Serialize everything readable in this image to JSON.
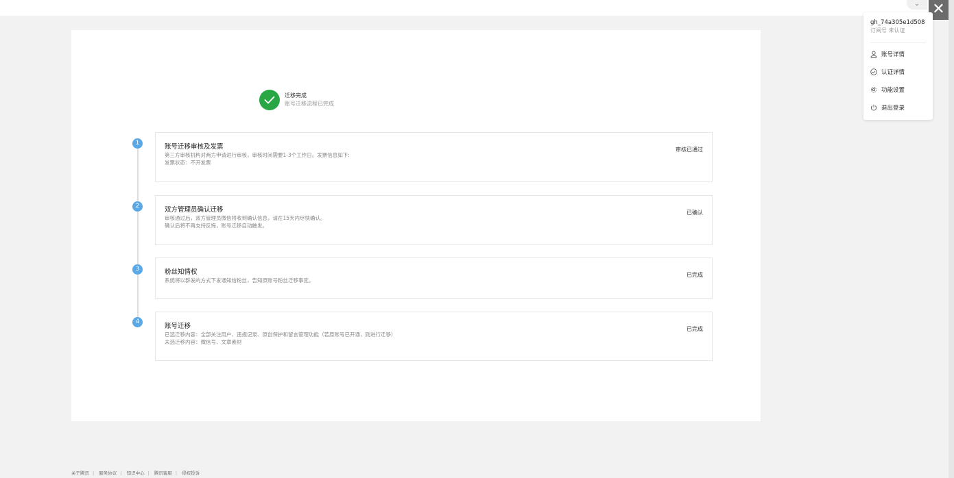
{
  "topbar": {
    "chevron_icon": "chevron-down-icon",
    "close_icon": "close-icon",
    "close_glyph": "✕",
    "chevron_glyph": "⌄"
  },
  "success": {
    "icon": "check-circle-icon",
    "title": "迁移完成",
    "subtitle": "账号迁移流程已完成",
    "color": "#29a745"
  },
  "steps": [
    {
      "number": "1",
      "title": "账号迁移审核及发票",
      "desc": [
        "第三方审核机构对两方申请进行审核，审核时间需要1-3个工作日。发票信息如下:",
        "发票状态：不开发票"
      ],
      "status": "审核已通过"
    },
    {
      "number": "2",
      "title": "双方管理员确认迁移",
      "desc": [
        "审核通过后，双方管理员微信将收到确认信息，请在15天内尽快确认。",
        "确认后将不再支持反悔，账号迁移自动触发。"
      ],
      "status": "已确认"
    },
    {
      "number": "3",
      "title": "粉丝知情权",
      "desc": [
        "系统将以群发的方式下发通知给粉丝，告知原账号粉丝迁移事宜。"
      ],
      "status": "已完成"
    },
    {
      "number": "4",
      "title": "账号迁移",
      "desc": [
        "已选迁移内容：全部关注用户、违规记录、原创保护和留言管理功能（若原账号已开通，则进行迁移）",
        "未选迁移内容：微信号、文章素材"
      ],
      "status": "已完成"
    }
  ],
  "step_color": "#5aa8e6",
  "dropdown": {
    "account_name": "gh_74a305e1d508",
    "account_type": "订阅号  未认证",
    "items": [
      {
        "label": "账号详情",
        "icon": "user-icon"
      },
      {
        "label": "认证详情",
        "icon": "check-circle-outline-icon"
      },
      {
        "label": "功能设置",
        "icon": "gear-icon"
      },
      {
        "label": "退出登录",
        "icon": "power-icon"
      }
    ]
  },
  "footer": {
    "links": [
      "关于腾讯",
      "服务协议",
      "知识中心",
      "腾讯客服",
      "侵权投诉"
    ],
    "separator": "|"
  }
}
